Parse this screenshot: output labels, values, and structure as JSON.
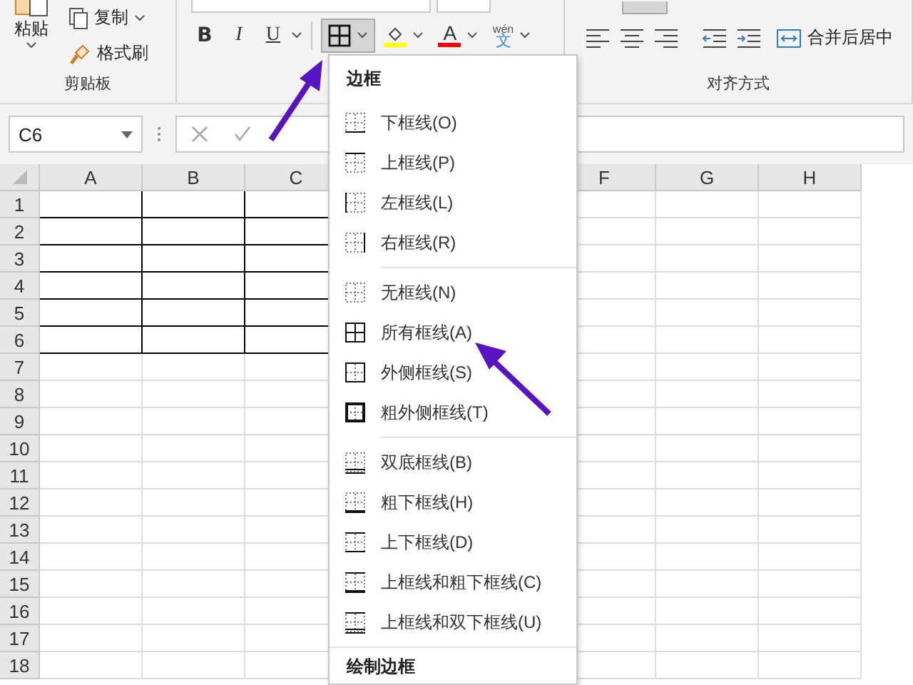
{
  "ribbon": {
    "clipboard": {
      "paste_label": "粘贴",
      "copy_label": "复制",
      "format_painter_label": "格式刷",
      "group_label": "剪贴板"
    },
    "font": {
      "bold": "B",
      "italic": "I",
      "underline": "U",
      "border_button": {
        "pressed": true
      },
      "font_color_letter": "A",
      "phonetic_top": "wén",
      "phonetic_bottom": "文"
    },
    "alignment": {
      "merge_label": "合并后居中",
      "group_label": "对齐方式"
    }
  },
  "formula_bar": {
    "name_box": "C6"
  },
  "sheet": {
    "columns": [
      {
        "label": "A",
        "bordered": true
      },
      {
        "label": "B",
        "bordered": true
      },
      {
        "label": "C",
        "bordered": true
      }
    ],
    "columns_after_menu": [
      {
        "label": "F",
        "bordered": false
      },
      {
        "label": "G",
        "bordered": false
      },
      {
        "label": "H",
        "bordered": false
      }
    ],
    "rows": [
      {
        "label": "1",
        "bordered": true
      },
      {
        "label": "2",
        "bordered": true
      },
      {
        "label": "3",
        "bordered": true
      },
      {
        "label": "4",
        "bordered": true
      },
      {
        "label": "5",
        "bordered": true
      },
      {
        "label": "6",
        "bordered": true
      },
      {
        "label": "7",
        "bordered": false
      },
      {
        "label": "8",
        "bordered": false
      },
      {
        "label": "9",
        "bordered": false
      },
      {
        "label": "10",
        "bordered": false
      },
      {
        "label": "11",
        "bordered": false
      },
      {
        "label": "12",
        "bordered": false
      },
      {
        "label": "13",
        "bordered": false
      },
      {
        "label": "14",
        "bordered": false
      },
      {
        "label": "15",
        "bordered": false
      },
      {
        "label": "16",
        "bordered": false
      },
      {
        "label": "17",
        "bordered": false
      },
      {
        "label": "18",
        "bordered": false
      }
    ]
  },
  "border_menu": {
    "title": "边框",
    "sections": [
      [
        {
          "label": "下框线(O)",
          "kind": "bottom"
        },
        {
          "label": "上框线(P)",
          "kind": "top"
        },
        {
          "label": "左框线(L)",
          "kind": "left"
        },
        {
          "label": "右框线(R)",
          "kind": "right"
        }
      ],
      [
        {
          "label": "无框线(N)",
          "kind": "none"
        },
        {
          "label": "所有框线(A)",
          "kind": "all"
        },
        {
          "label": "外侧框线(S)",
          "kind": "outside"
        },
        {
          "label": "粗外侧框线(T)",
          "kind": "thick-outside"
        }
      ],
      [
        {
          "label": "双底框线(B)",
          "kind": "double-bottom"
        },
        {
          "label": "粗下框线(H)",
          "kind": "thick-bottom"
        },
        {
          "label": "上下框线(D)",
          "kind": "top-bottom"
        },
        {
          "label": "上框线和粗下框线(C)",
          "kind": "top-thick-bottom"
        },
        {
          "label": "上框线和双下框线(U)",
          "kind": "top-double-bottom"
        }
      ]
    ],
    "footer_label": "绘制边框"
  }
}
